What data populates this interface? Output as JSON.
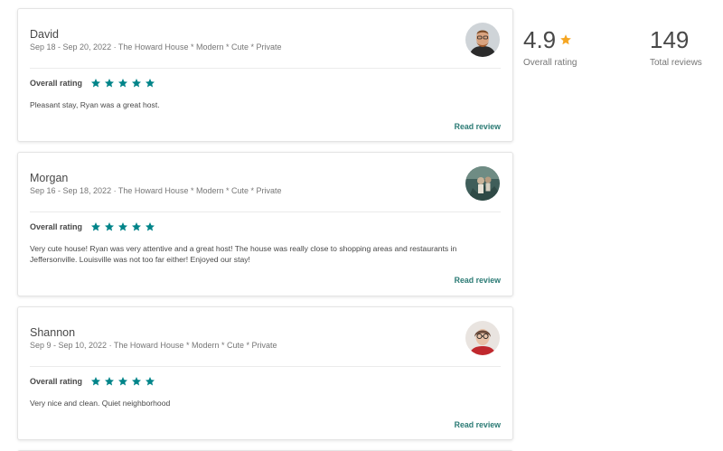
{
  "reviews": [
    {
      "name": "David",
      "stay": "Sep 18 - Sep 20, 2022 · The Howard House * Modern * Cute * Private",
      "rating_label": "Overall rating",
      "text": "Pleasant stay, Ryan was a great host.",
      "read_label": "Read review"
    },
    {
      "name": "Morgan",
      "stay": "Sep 16 - Sep 18, 2022 · The Howard House * Modern * Cute * Private",
      "rating_label": "Overall rating",
      "text": "Very cute house! Ryan was very attentive and a great host! The house was really close to shopping areas and restaurants in Jeffersonville. Louisville was not too far either! Enjoyed our stay!",
      "read_label": "Read review"
    },
    {
      "name": "Shannon",
      "stay": "Sep 9 - Sep 10, 2022 · The Howard House * Modern * Cute * Private",
      "rating_label": "Overall rating",
      "text": "Very nice and clean. Quiet neighborhood",
      "read_label": "Read review"
    }
  ],
  "stars_per_review": 5,
  "summary": {
    "overall_rating": "4.9",
    "overall_label": "Overall rating",
    "total_reviews": "149",
    "total_label": "Total reviews"
  },
  "colors": {
    "review_star": "#008489",
    "summary_star": "#f5a623",
    "link": "#2a7a74"
  },
  "icons": {
    "review_star": "star-icon",
    "summary_star": "star-icon"
  }
}
